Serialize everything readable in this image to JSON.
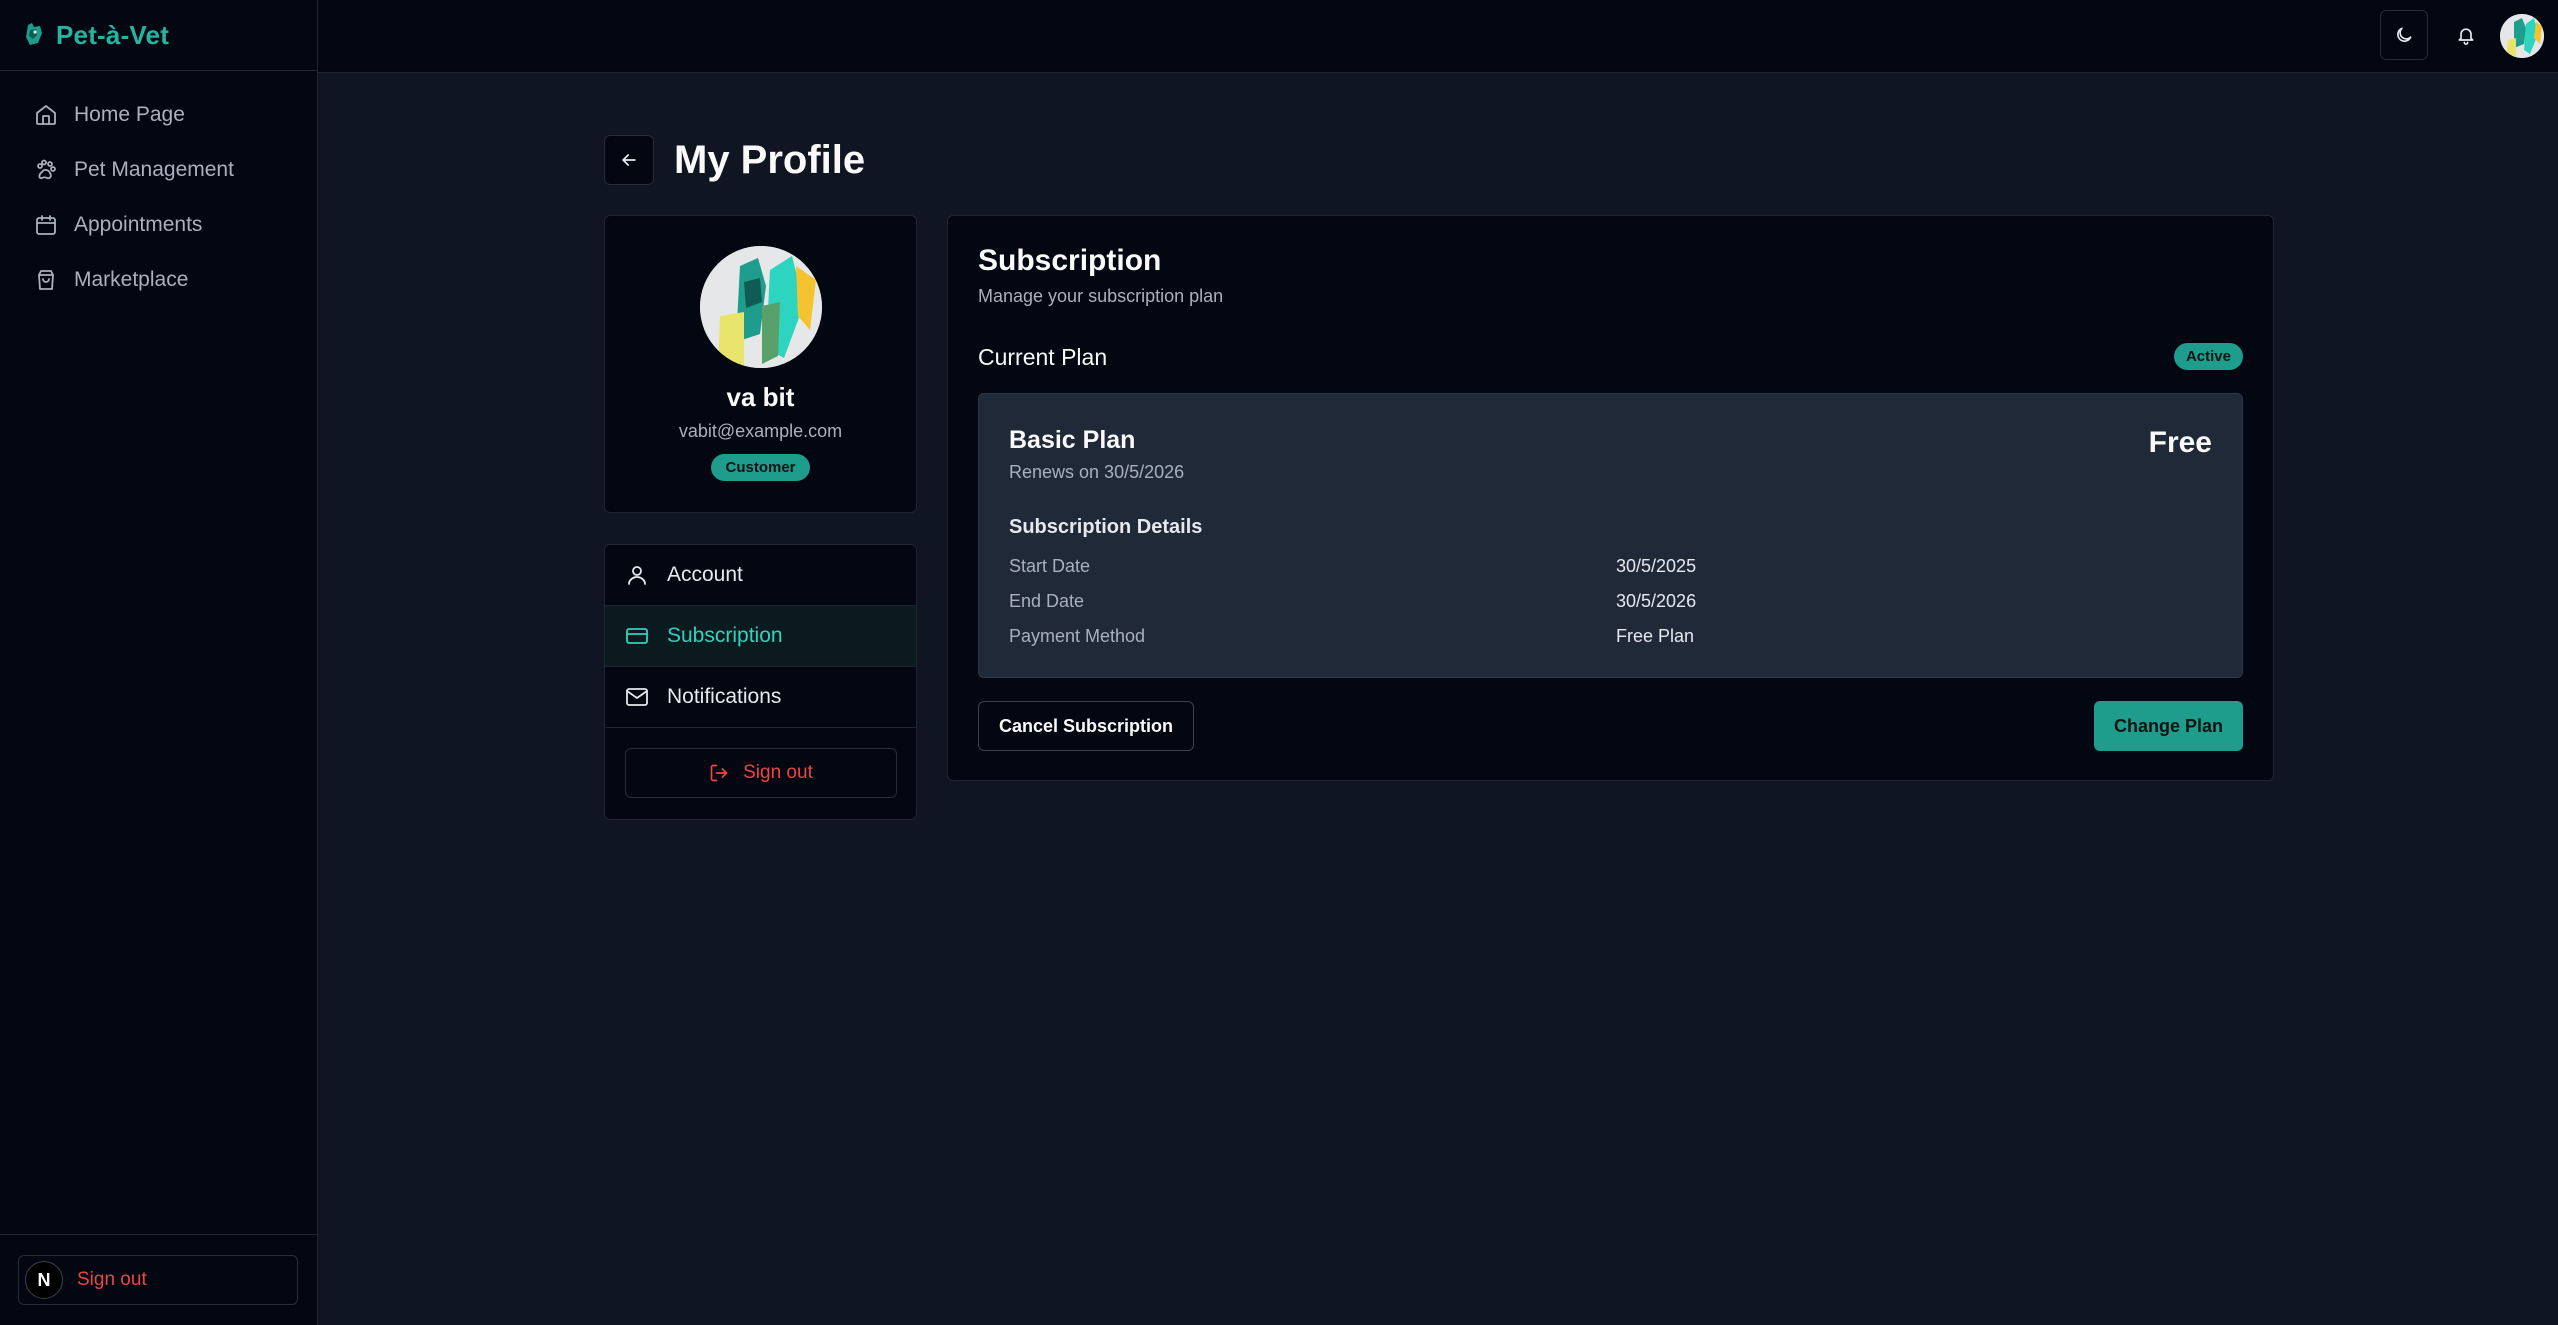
{
  "app": {
    "name": "Pet-à-Vet"
  },
  "sidebar": {
    "items": [
      {
        "label": "Home Page",
        "icon": "home-icon"
      },
      {
        "label": "Pet Management",
        "icon": "paw-icon"
      },
      {
        "label": "Appointments",
        "icon": "calendar-icon"
      },
      {
        "label": "Marketplace",
        "icon": "shopping-bag-icon"
      }
    ],
    "footer": {
      "avatar_letter": "N",
      "signout_label": "Sign out"
    }
  },
  "topbar": {
    "theme_icon": "moon-icon",
    "bell_icon": "bell-icon"
  },
  "page": {
    "title": "My Profile"
  },
  "profile": {
    "name": "va bit",
    "email": "vabit@example.com",
    "role": "Customer"
  },
  "menu": {
    "items": [
      {
        "label": "Account",
        "icon": "user-icon",
        "active": false
      },
      {
        "label": "Subscription",
        "icon": "credit-card-icon",
        "active": true
      },
      {
        "label": "Notifications",
        "icon": "mail-icon",
        "active": false
      }
    ],
    "signout_label": "Sign out"
  },
  "subscription": {
    "title": "Subscription",
    "description": "Manage your subscription plan",
    "current_plan_label": "Current Plan",
    "status": "Active",
    "plan": {
      "name": "Basic Plan",
      "renews": "Renews on 30/5/2026",
      "price": "Free"
    },
    "details_title": "Subscription Details",
    "details": [
      {
        "label": "Start Date",
        "value": "30/5/2025"
      },
      {
        "label": "End Date",
        "value": "30/5/2026"
      },
      {
        "label": "Payment Method",
        "value": "Free Plan"
      }
    ],
    "cancel_label": "Cancel Subscription",
    "change_label": "Change Plan"
  },
  "colors": {
    "accent": "#1f9d8c",
    "accent_text": "#2dd4bf",
    "danger": "#ef4444",
    "background": "#101522",
    "panel": "#030712"
  }
}
